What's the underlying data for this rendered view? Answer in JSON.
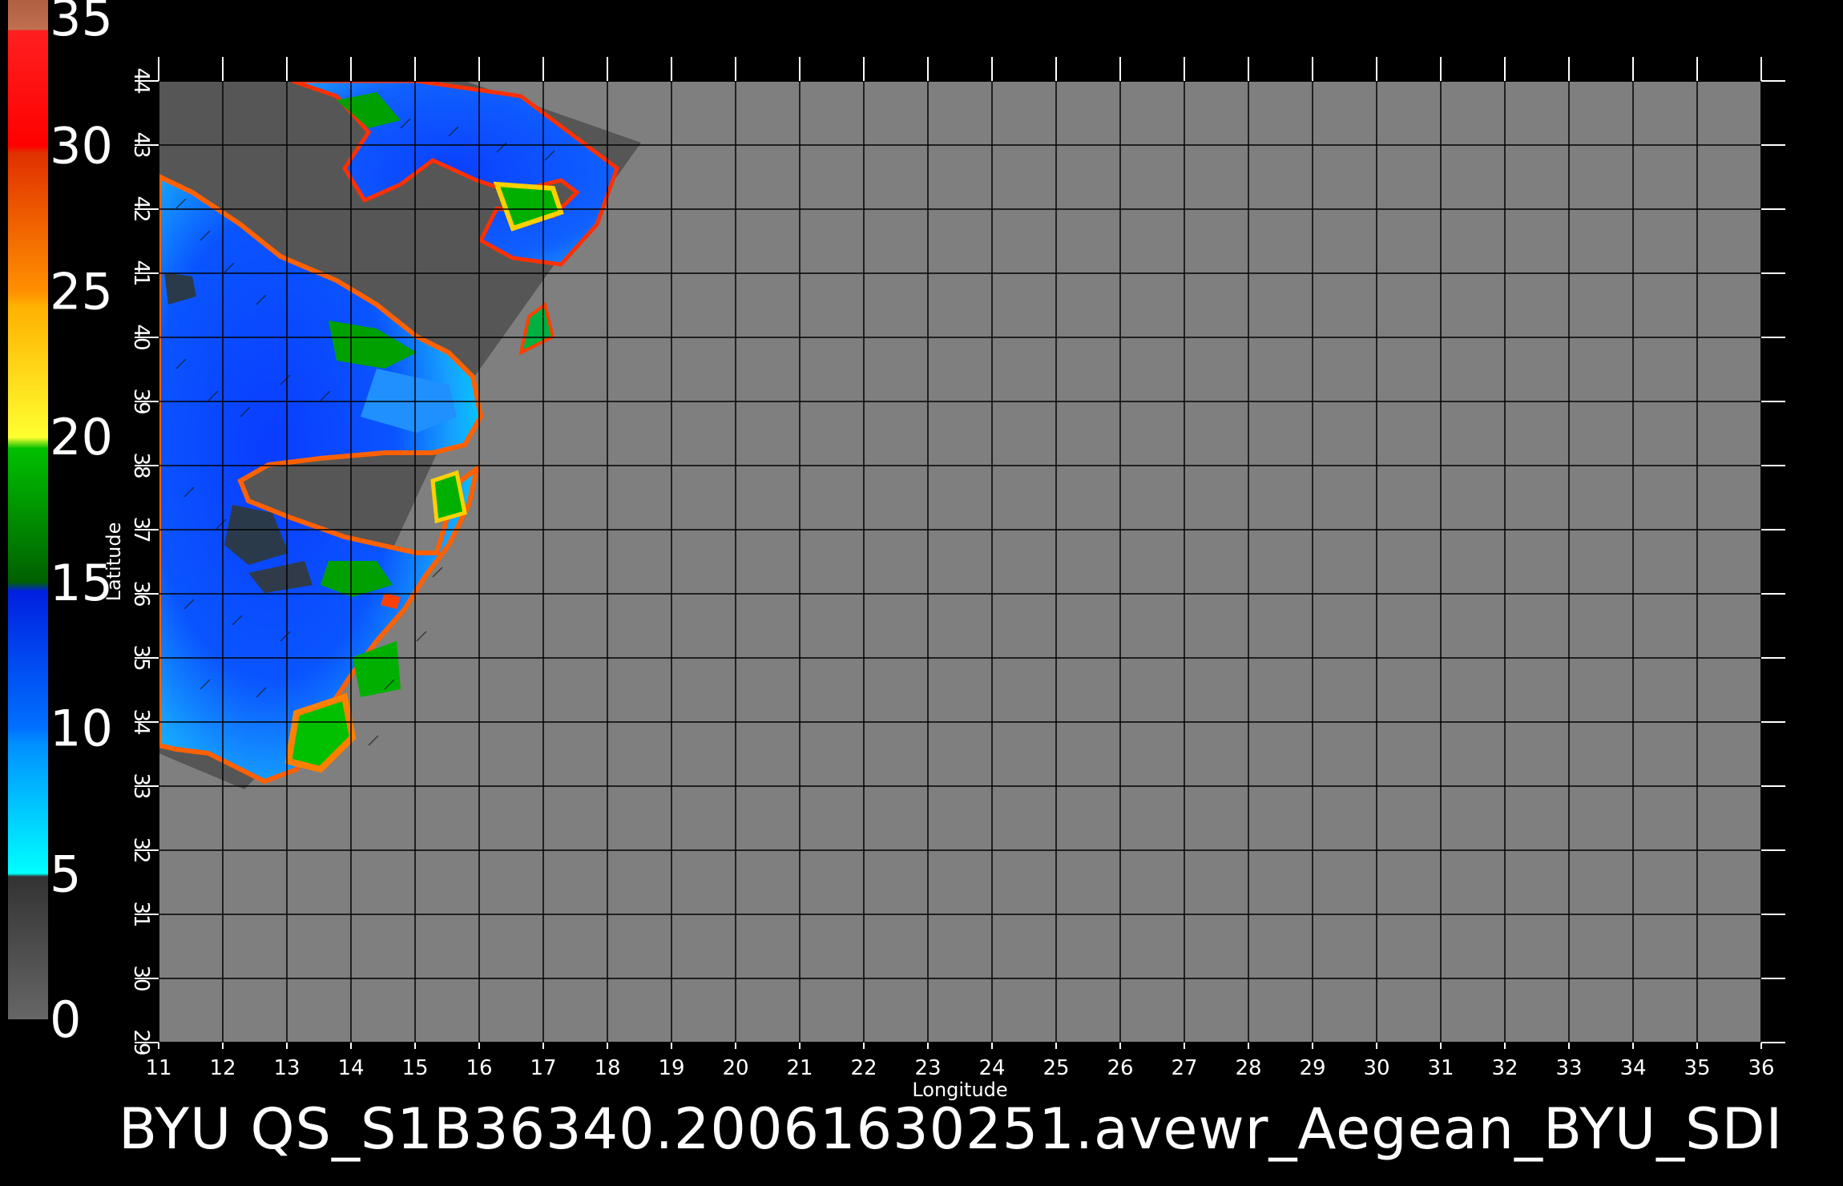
{
  "map": {
    "caption": "BYU  QS_S1B36340.20061630251.avewr_Aegean_BYU_SDI",
    "x_axis": {
      "label": "Longitude",
      "range": [
        11,
        36
      ],
      "ticks": [
        "11",
        "12",
        "13",
        "14",
        "15",
        "16",
        "17",
        "18",
        "19",
        "20",
        "21",
        "22",
        "23",
        "24",
        "25",
        "26",
        "27",
        "28",
        "29",
        "30",
        "31",
        "32",
        "33",
        "34",
        "35",
        "36"
      ]
    },
    "y_axis": {
      "label": "Latitude",
      "range": [
        29,
        44
      ],
      "ticks": [
        "29",
        "30",
        "31",
        "32",
        "33",
        "34",
        "35",
        "36",
        "37",
        "38",
        "39",
        "40",
        "41",
        "42",
        "43",
        "44"
      ]
    },
    "grid": true,
    "colorbar": {
      "range": [
        0,
        35
      ],
      "labels": [
        "0",
        "5",
        "10",
        "15",
        "20",
        "25",
        "30",
        "35"
      ],
      "colors": {
        "0-5": "#505050",
        "5-10": "#00c8ff",
        "10-15": "#0040e0",
        "15-20": "#00a000",
        "20-25": "#ffd000",
        "25-30": "#ff6a00",
        "30-35": "#ff1a00",
        "35+": "#c07050"
      }
    },
    "colors": {
      "background": "#000000",
      "ocean_fill": "#7f7f7f",
      "swath_gray": "#595959",
      "grid_lines": "#000000",
      "land": "#5a5a5a"
    }
  }
}
